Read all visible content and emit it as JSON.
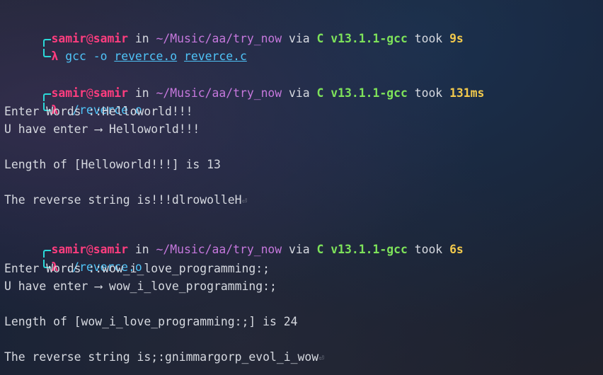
{
  "theme": {
    "user_color": "#ff3d7f",
    "path_color": "#c678dd",
    "lang_color": "#7ee35a",
    "time_color": "#f2c94c",
    "cmd_color": "#4fc3f7",
    "corner_color": "#2bd9d9"
  },
  "prompt": {
    "user": "samir",
    "at": "@",
    "host": "samir",
    "in_word": "in",
    "path": "~/Music/aa/try_now",
    "via_word": "via",
    "lang": "C v13.1.1-gcc",
    "took_word": "took",
    "lambda": "λ"
  },
  "blocks": [
    {
      "took": "9s",
      "command": "gcc -o",
      "args": [
        "reverce.o",
        "reverce.c"
      ]
    },
    {
      "took": "131ms",
      "command": "./reverce.o",
      "output": [
        "Enter Words ::Helloworld!!!",
        "U have enter ⟶ Helloworld!!!",
        "",
        "Length of [Helloworld!!!] is 13",
        "",
        "The reverse string is!!!dlrowolleH"
      ]
    },
    {
      "took": "6s",
      "command": "./reverce.o",
      "output": [
        "Enter Words ::wow_i_love_programming:;",
        "U have enter ⟶ wow_i_love_programming:;",
        "",
        "Length of [wow_i_love_programming:;] is 24",
        "",
        "The reverse string is;:gnimmargorp_evol_i_wow"
      ]
    }
  ],
  "enter_symbol": "⏎"
}
